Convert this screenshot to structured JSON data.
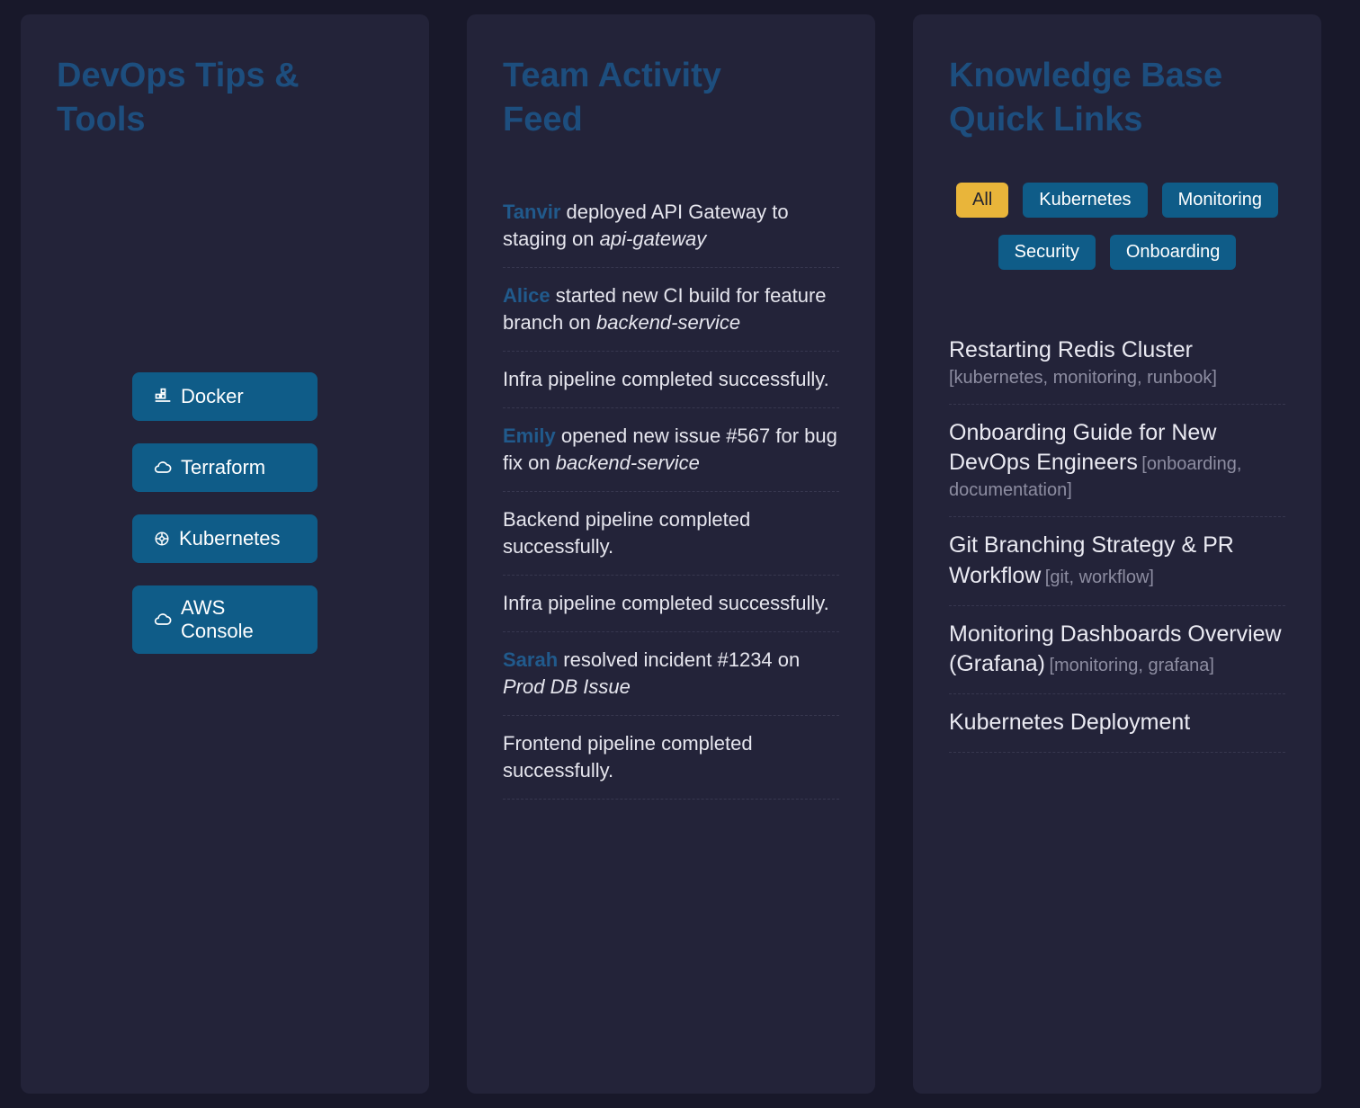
{
  "colors": {
    "page_background": "#18182a",
    "card_background": "#232339",
    "title_blue": "#1d4e7e",
    "button_blue": "#0f5c88",
    "active_filter_yellow": "#e9b53a",
    "tag_gray": "#8d8da1"
  },
  "tools_card": {
    "title": "DevOps Tips & Tools",
    "buttons": [
      {
        "label": "Docker",
        "icon": "docker-icon"
      },
      {
        "label": "Terraform",
        "icon": "cloud-icon"
      },
      {
        "label": "Kubernetes",
        "icon": "kubernetes-wheel-icon"
      },
      {
        "label": "AWS Console",
        "icon": "cloud-icon"
      }
    ]
  },
  "activity_card": {
    "title": "Team Activity Feed",
    "items": [
      {
        "name": "Tanvir",
        "text": "deployed API Gateway to staging on",
        "repo": "api-gateway"
      },
      {
        "name": "Alice",
        "text": "started new CI build for feature branch on",
        "repo": "backend-service"
      },
      {
        "text": "Infra pipeline completed successfully."
      },
      {
        "name": "Emily",
        "text": "opened new issue #567 for bug fix on",
        "repo": "backend-service"
      },
      {
        "text": "Backend pipeline completed successfully."
      },
      {
        "text": "Infra pipeline completed successfully."
      },
      {
        "name": "Sarah",
        "text": "resolved incident #1234 on",
        "repo": "Prod DB Issue"
      },
      {
        "text": "Frontend pipeline completed successfully."
      }
    ]
  },
  "kb_card": {
    "title": "Knowledge Base Quick Links",
    "filters": [
      {
        "label": "All",
        "active": true
      },
      {
        "label": "Kubernetes",
        "active": false
      },
      {
        "label": "Monitoring",
        "active": false
      },
      {
        "label": "Security",
        "active": false
      },
      {
        "label": "Onboarding",
        "active": false
      }
    ],
    "links": [
      {
        "title": "Restarting Redis Cluster",
        "tags": "[kubernetes, monitoring, runbook]"
      },
      {
        "title": "Onboarding Guide for New DevOps Engineers",
        "tags": "[onboarding, documentation]"
      },
      {
        "title": "Git Branching Strategy & PR Workflow",
        "tags": "[git, workflow]"
      },
      {
        "title": "Monitoring Dashboards Overview (Grafana)",
        "tags": "[monitoring, grafana]"
      },
      {
        "title": "Kubernetes Deployment",
        "tags": ""
      }
    ]
  }
}
